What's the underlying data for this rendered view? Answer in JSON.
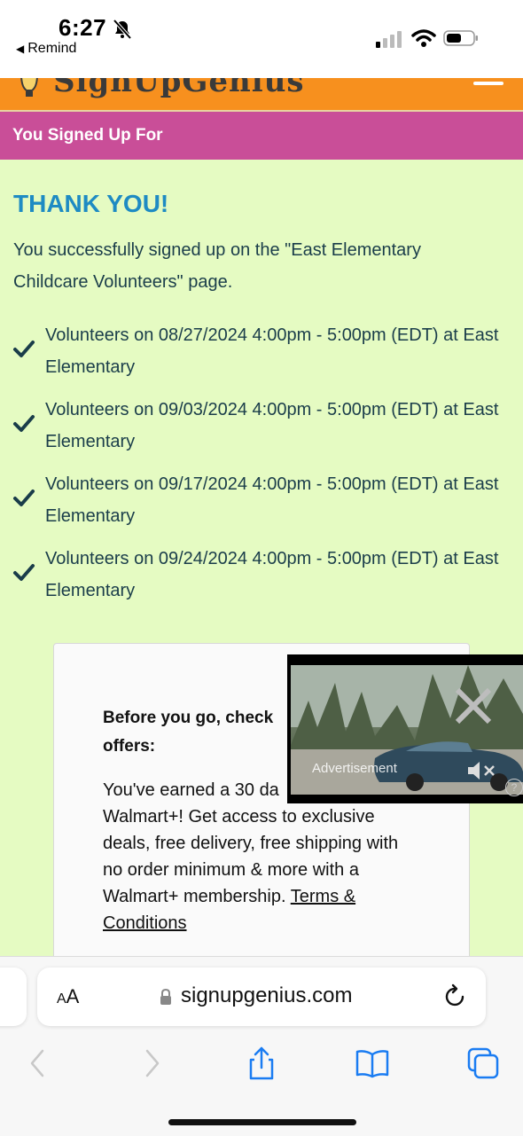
{
  "status_bar": {
    "time": "6:27",
    "back_app": "Remind"
  },
  "brand": {
    "name": "SignUpGenius"
  },
  "section_header": "You Signed Up For",
  "confirmation": {
    "title": "THANK YOU!",
    "message": "You successfully signed up on the \"East Elementary Childcare Volunteers\" page.",
    "slots": [
      {
        "text": "Volunteers on 08/27/2024 4:00pm - 5:00pm (EDT) at East Elementary"
      },
      {
        "text": "Volunteers on 09/03/2024 4:00pm - 5:00pm (EDT) at East Elementary"
      },
      {
        "text": "Volunteers on 09/17/2024 4:00pm - 5:00pm (EDT) at East Elementary"
      },
      {
        "text": "Volunteers on 09/24/2024 4:00pm - 5:00pm (EDT) at East Elementary"
      }
    ]
  },
  "offer": {
    "title": "Before you go, check",
    "title_2": "offers:",
    "body_1": "You've earned a 30 da",
    "body_2": "Walmart+! Get access to exclusive deals, free delivery, free shipping with no order minimum & more with a Walmart+ membership.",
    "terms_link": "Terms & Conditions"
  },
  "ad": {
    "label": "Advertisement",
    "help": "?"
  },
  "browser": {
    "aa_label_small": "A",
    "aa_label_large": "A",
    "url": "signupgenius.com"
  },
  "colors": {
    "page_bg": "#e5fbc2",
    "brand_orange": "#f7901e",
    "section_magenta": "#c94e98",
    "title_blue": "#1e8bc3",
    "text_navy": "#1a3d4a",
    "ios_blue": "#1a7cf2"
  }
}
